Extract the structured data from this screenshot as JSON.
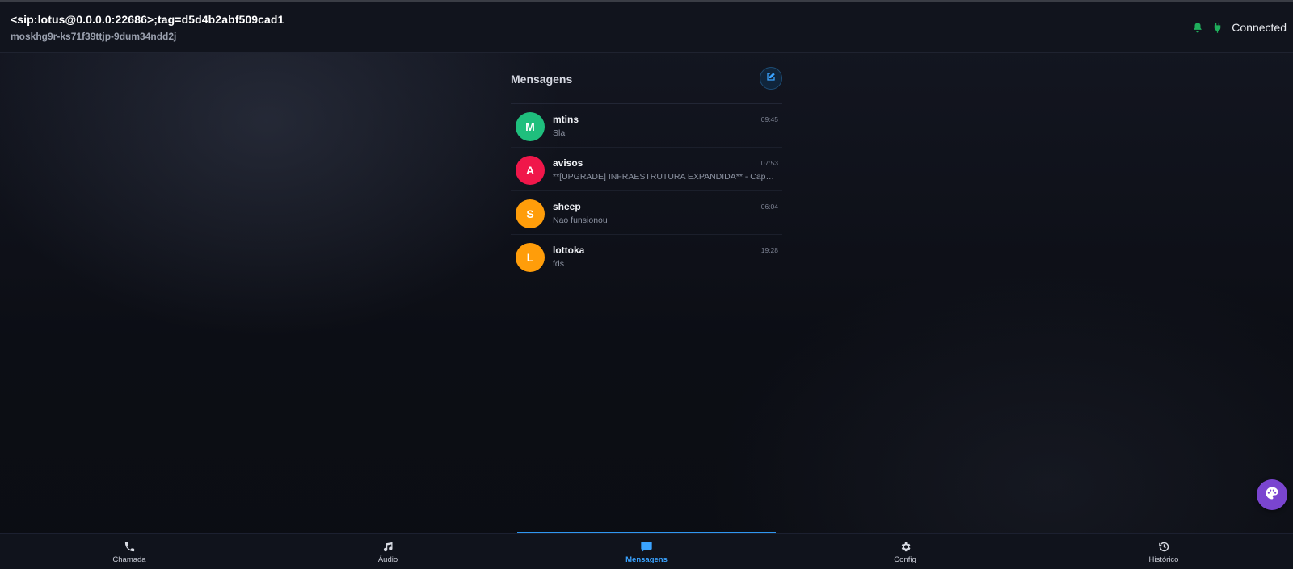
{
  "header": {
    "title": "<sip:lotus@0.0.0.0:22686>;tag=d5d4b2abf509cad1",
    "subtitle": "moskhg9r-ks71f39ttjp-9dum34ndd2j",
    "status_label": "Connected",
    "icons": [
      "bell-icon",
      "plug-icon"
    ]
  },
  "messages": {
    "title": "Mensagens",
    "compose_icon": "edit-icon",
    "conversations": [
      {
        "initial": "M",
        "name": "mtins",
        "time": "09:45",
        "preview": "Sla",
        "color": "#1fbf7d"
      },
      {
        "initial": "A",
        "name": "avisos",
        "time": "07:53",
        "preview": "**[UPGRADE] INFRAESTRUTURA EXPANDIDA** - Capacidade de processamento ampliada",
        "color": "#f0174a"
      },
      {
        "initial": "S",
        "name": "sheep",
        "time": "06:04",
        "preview": "Nao funsionou",
        "color": "#ff9d0a"
      },
      {
        "initial": "L",
        "name": "lottoka",
        "time": "19:28",
        "preview": "fds",
        "color": "#ff9d0a"
      }
    ]
  },
  "theme_button": {
    "icon": "palette-icon",
    "color": "#7a45d0"
  },
  "nav": {
    "items": [
      {
        "label": "Chamada",
        "icon": "phone-icon"
      },
      {
        "label": "Áudio",
        "icon": "music-icon"
      },
      {
        "label": "Mensagens",
        "icon": "chat-icon"
      },
      {
        "label": "Config",
        "icon": "gear-icon"
      },
      {
        "label": "Histórico",
        "icon": "history-icon"
      }
    ],
    "active_index": 2,
    "accent": "#2f97f0"
  },
  "colors": {
    "status_green": "#1fae5c",
    "accent_blue": "#3aa3ff"
  }
}
